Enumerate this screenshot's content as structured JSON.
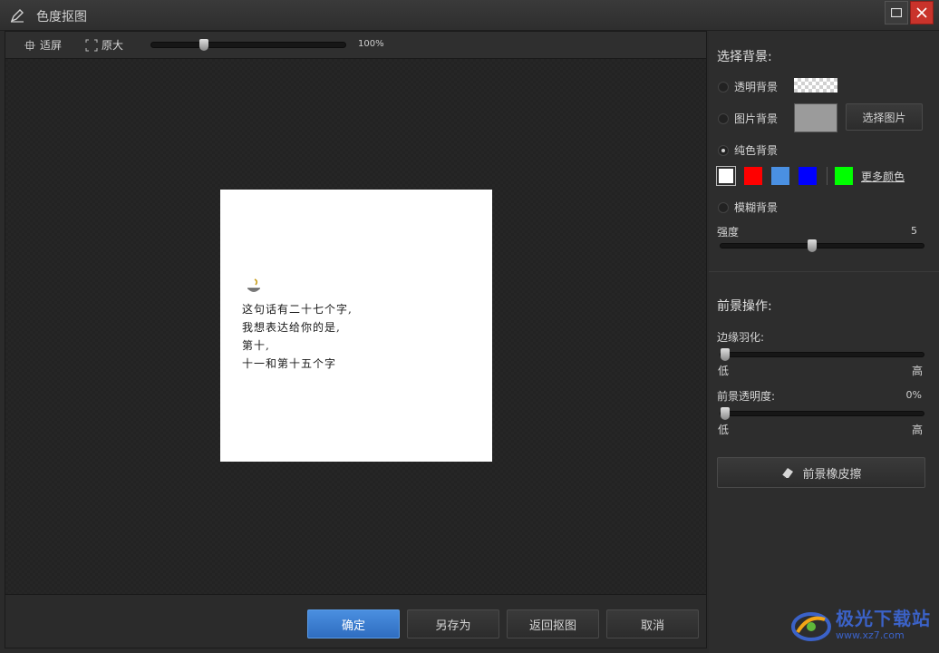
{
  "window": {
    "title": "色度抠图"
  },
  "toolbar": {
    "fit_label": "适屏",
    "original_label": "原大",
    "zoom_text": "100%",
    "zoom_fraction": 0.26
  },
  "preview": {
    "lines": [
      "这句话有二十七个字,",
      "我想表达给你的是,",
      "第十,",
      "十一和第十五个字"
    ]
  },
  "buttons": {
    "confirm": "确定",
    "save_as": "另存为",
    "back": "返回抠图",
    "cancel": "取消"
  },
  "background": {
    "heading": "选择背景:",
    "transparent_label": "透明背景",
    "image_label": "图片背景",
    "choose_image": "选择图片",
    "solid_label": "纯色背景",
    "blur_label": "模糊背景",
    "selected": "solid",
    "swatches": [
      "#ffffff",
      "#ff0000",
      "#4a90e2",
      "#0000ff",
      "#00ff00"
    ],
    "selected_swatch": 0,
    "more_colors": "更多颜色",
    "strength_label": "强度",
    "strength_value": "5",
    "strength_fraction": 0.45
  },
  "foreground": {
    "heading": "前景操作:",
    "feather_label": "边缘羽化:",
    "feather_low": "低",
    "feather_high": "高",
    "feather_fraction": 0,
    "opacity_label": "前景透明度:",
    "opacity_value": "0%",
    "opacity_low": "低",
    "opacity_high": "高",
    "opacity_fraction": 0,
    "eraser_label": "前景橡皮擦"
  },
  "watermark": {
    "name": "极光下载站",
    "url": "www.xz7.com"
  }
}
